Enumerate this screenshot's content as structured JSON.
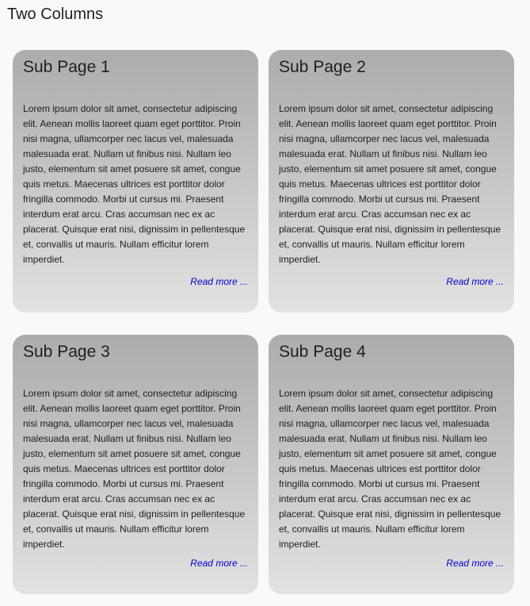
{
  "page": {
    "title": "Two Columns"
  },
  "cards": [
    {
      "title": "Sub Page 1",
      "body": "Lorem ipsum dolor sit amet, consectetur adipiscing elit. Aenean mollis laoreet quam eget porttitor. Proin nisi magna, ullamcorper nec lacus vel, malesuada malesuada erat. Nullam ut finibus nisi. Nullam leo justo, elementum sit amet posuere sit amet, congue quis metus. Maecenas ultrices est porttitor dolor fringilla commodo. Morbi ut cursus mi. Praesent interdum erat arcu. Cras accumsan nec ex ac placerat. Quisque erat nisi, dignissim in pellentesque et, convallis ut mauris. Nullam efficitur lorem imperdiet.",
      "link": "Read more ..."
    },
    {
      "title": "Sub Page 2",
      "body": "Lorem ipsum dolor sit amet, consectetur adipiscing elit. Aenean mollis laoreet quam eget porttitor. Proin nisi magna, ullamcorper nec lacus vel, malesuada malesuada erat. Nullam ut finibus nisi. Nullam leo justo, elementum sit amet posuere sit amet, congue quis metus. Maecenas ultrices est porttitor dolor fringilla commodo. Morbi ut cursus mi. Praesent interdum erat arcu. Cras accumsan nec ex ac placerat. Quisque erat nisi, dignissim in pellentesque et, convallis ut mauris. Nullam efficitur lorem imperdiet.",
      "link": "Read more ..."
    },
    {
      "title": "Sub Page 3",
      "body": "Lorem ipsum dolor sit amet, consectetur adipiscing elit. Aenean mollis laoreet quam eget porttitor. Proin nisi magna, ullamcorper nec lacus vel, malesuada malesuada erat. Nullam ut finibus nisi. Nullam leo justo, elementum sit amet posuere sit amet, congue quis metus. Maecenas ultrices est porttitor dolor fringilla commodo. Morbi ut cursus mi. Praesent interdum erat arcu. Cras accumsan nec ex ac placerat. Quisque erat nisi, dignissim in pellentesque et, convallis ut mauris. Nullam efficitur lorem imperdiet.",
      "link": "Read more ..."
    },
    {
      "title": "Sub Page 4",
      "body": "Lorem ipsum dolor sit amet, consectetur adipiscing elit. Aenean mollis laoreet quam eget porttitor. Proin nisi magna, ullamcorper nec lacus vel, malesuada malesuada erat. Nullam ut finibus nisi. Nullam leo justo, elementum sit amet posuere sit amet, congue quis metus. Maecenas ultrices est porttitor dolor fringilla commodo. Morbi ut cursus mi. Praesent interdum erat arcu. Cras accumsan nec ex ac placerat. Quisque erat nisi, dignissim in pellentesque et, convallis ut mauris. Nullam efficitur lorem imperdiet.",
      "link": "Read more ..."
    }
  ],
  "colors": {
    "link": "#0000cc",
    "background": "#f8f9fa",
    "card_top": "#acacac",
    "card_bottom": "#e2e2e2"
  }
}
